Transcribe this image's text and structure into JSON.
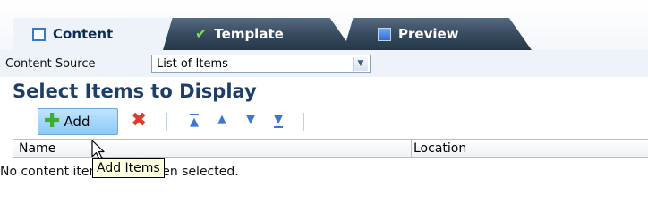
{
  "tabs": [
    {
      "label": "Content",
      "icon": "square-outline-icon",
      "active": true
    },
    {
      "label": "Template",
      "icon": "checkmark-icon",
      "active": false
    },
    {
      "label": "Preview",
      "icon": "square-filled-icon",
      "active": false
    }
  ],
  "content_source": {
    "label": "Content Source",
    "value": "List of Items"
  },
  "section_title": "Select Items to Display",
  "toolbar": {
    "add_label": "Add",
    "tooltip": "Add Items"
  },
  "table": {
    "columns": [
      "Name",
      "Location"
    ],
    "empty_message": "No content items have been selected."
  },
  "colors": {
    "accent": "#3d77cc",
    "heading": "#1d3e66",
    "active_tab_bg": "#eef3fa",
    "inactive_tab_bg": "#3a4d62"
  }
}
